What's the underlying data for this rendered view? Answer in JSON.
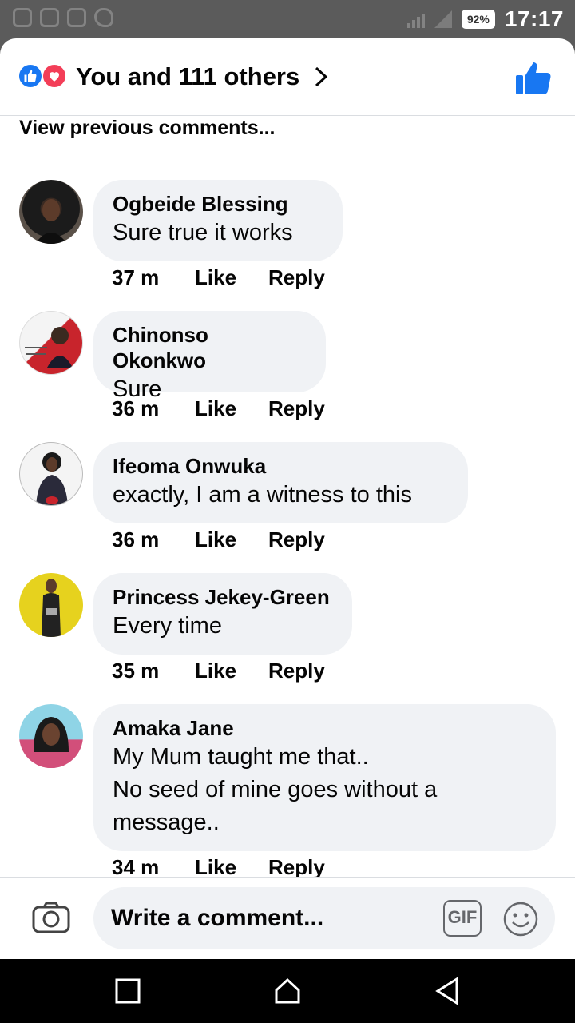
{
  "status_bar": {
    "battery": "92%",
    "time": "17:17"
  },
  "header": {
    "reactions_label": "You and 111 others"
  },
  "view_previous": "View previous comments...",
  "comments": [
    {
      "name": "Ogbeide Blessing",
      "text": "Sure true it works",
      "time": "37 m",
      "like": "Like",
      "reply": "Reply"
    },
    {
      "name": "Chinonso Okonkwo",
      "text": "Sure",
      "time": "36 m",
      "like": "Like",
      "reply": "Reply"
    },
    {
      "name": "Ifeoma Onwuka",
      "text": "exactly, I am a witness to this",
      "time": "36 m",
      "like": "Like",
      "reply": "Reply"
    },
    {
      "name": "Princess Jekey-Green",
      "text": "Every time",
      "time": "35 m",
      "like": "Like",
      "reply": "Reply"
    },
    {
      "name": "Amaka Jane",
      "text_lines": [
        "My Mum taught me that..",
        "No seed of mine goes without a",
        "message.."
      ],
      "time": "34 m",
      "like": "Like",
      "reply": "Reply"
    }
  ],
  "composer": {
    "placeholder": "Write a comment...",
    "gif_label": "GIF"
  },
  "colors": {
    "facebook_blue": "#1877f2",
    "love_red": "#f33e58",
    "bubble_gray": "#f0f2f5"
  },
  "icons": [
    "like-reaction-icon",
    "love-reaction-icon",
    "chevron-right-icon",
    "thumbs-up-icon",
    "camera-icon",
    "gif-icon",
    "emoji-icon",
    "recent-apps-icon",
    "home-icon",
    "back-icon"
  ]
}
